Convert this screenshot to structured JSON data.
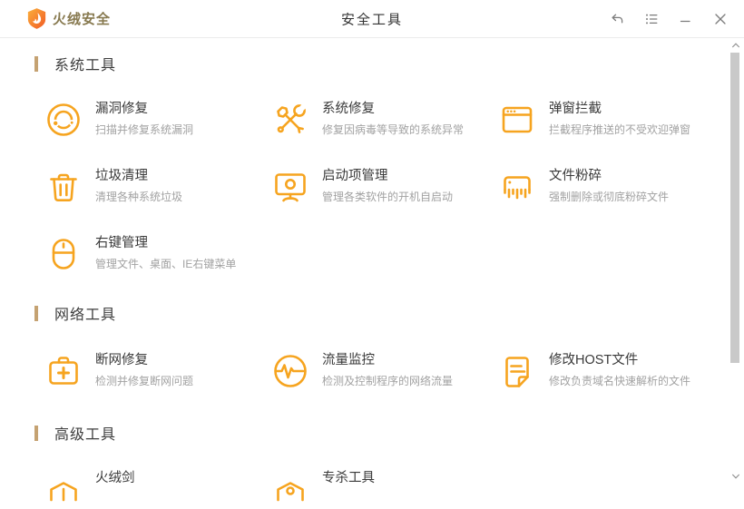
{
  "titlebar": {
    "app_name": "火绒安全",
    "page_title": "安全工具",
    "controls": {
      "undo_icon": "undo-icon",
      "menu_icon": "list-menu-icon",
      "minimize_icon": "minimize-icon",
      "close_icon": "close-icon"
    }
  },
  "colors": {
    "brand_orange": "#F6A41F",
    "logo_text": "#87794F",
    "section_bar": "#C5A272",
    "item_title": "#3A3A3A",
    "item_desc": "#A2A2A2"
  },
  "sections": [
    {
      "label": "系统工具",
      "items": [
        {
          "title": "漏洞修复",
          "desc": "扫描并修复系统漏洞",
          "icon": "vulnerability-fix-icon"
        },
        {
          "title": "系统修复",
          "desc": "修复因病毒等导致的系统异常",
          "icon": "system-repair-icon"
        },
        {
          "title": "弹窗拦截",
          "desc": "拦截程序推送的不受欢迎弹窗",
          "icon": "popup-blocker-icon"
        },
        {
          "title": "垃圾清理",
          "desc": "清理各种系统垃圾",
          "icon": "junk-clean-icon"
        },
        {
          "title": "启动项管理",
          "desc": "管理各类软件的开机自启动",
          "icon": "startup-manager-icon"
        },
        {
          "title": "文件粉碎",
          "desc": "强制删除或彻底粉碎文件",
          "icon": "file-shredder-icon"
        },
        {
          "title": "右键管理",
          "desc": "管理文件、桌面、IE右键菜单",
          "icon": "right-click-manager-icon"
        }
      ]
    },
    {
      "label": "网络工具",
      "items": [
        {
          "title": "断网修复",
          "desc": "检测并修复断网问题",
          "icon": "network-repair-icon"
        },
        {
          "title": "流量监控",
          "desc": "检测及控制程序的网络流量",
          "icon": "traffic-monitor-icon"
        },
        {
          "title": "修改HOST文件",
          "desc": "修改负责域名快速解析的文件",
          "icon": "host-file-icon"
        }
      ]
    },
    {
      "label": "高级工具",
      "items": [
        {
          "title": "火绒剑",
          "icon": "huorong-sword-icon"
        },
        {
          "title": "专杀工具",
          "icon": "special-kill-tool-icon"
        }
      ]
    }
  ]
}
